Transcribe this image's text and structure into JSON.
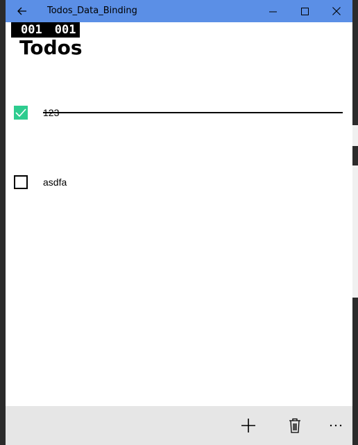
{
  "window": {
    "title": "Todos_Data_Binding",
    "accent_color": "#5b8fe6",
    "buttons": {
      "back": "back-arrow-icon",
      "minimize": "minimize-icon",
      "maximize": "maximize-icon",
      "close": "close-icon"
    }
  },
  "frame_counter": {
    "left": "001",
    "right": "001"
  },
  "page": {
    "title": "Todos"
  },
  "todos": [
    {
      "text": "123",
      "completed": true,
      "check_color": "#2ecc8f"
    },
    {
      "text": "asdfa",
      "completed": false
    }
  ],
  "command_bar": {
    "background": "#e6e6e6",
    "buttons": [
      {
        "icon": "add-icon"
      },
      {
        "icon": "delete-icon"
      },
      {
        "icon": "more-icon"
      }
    ]
  }
}
